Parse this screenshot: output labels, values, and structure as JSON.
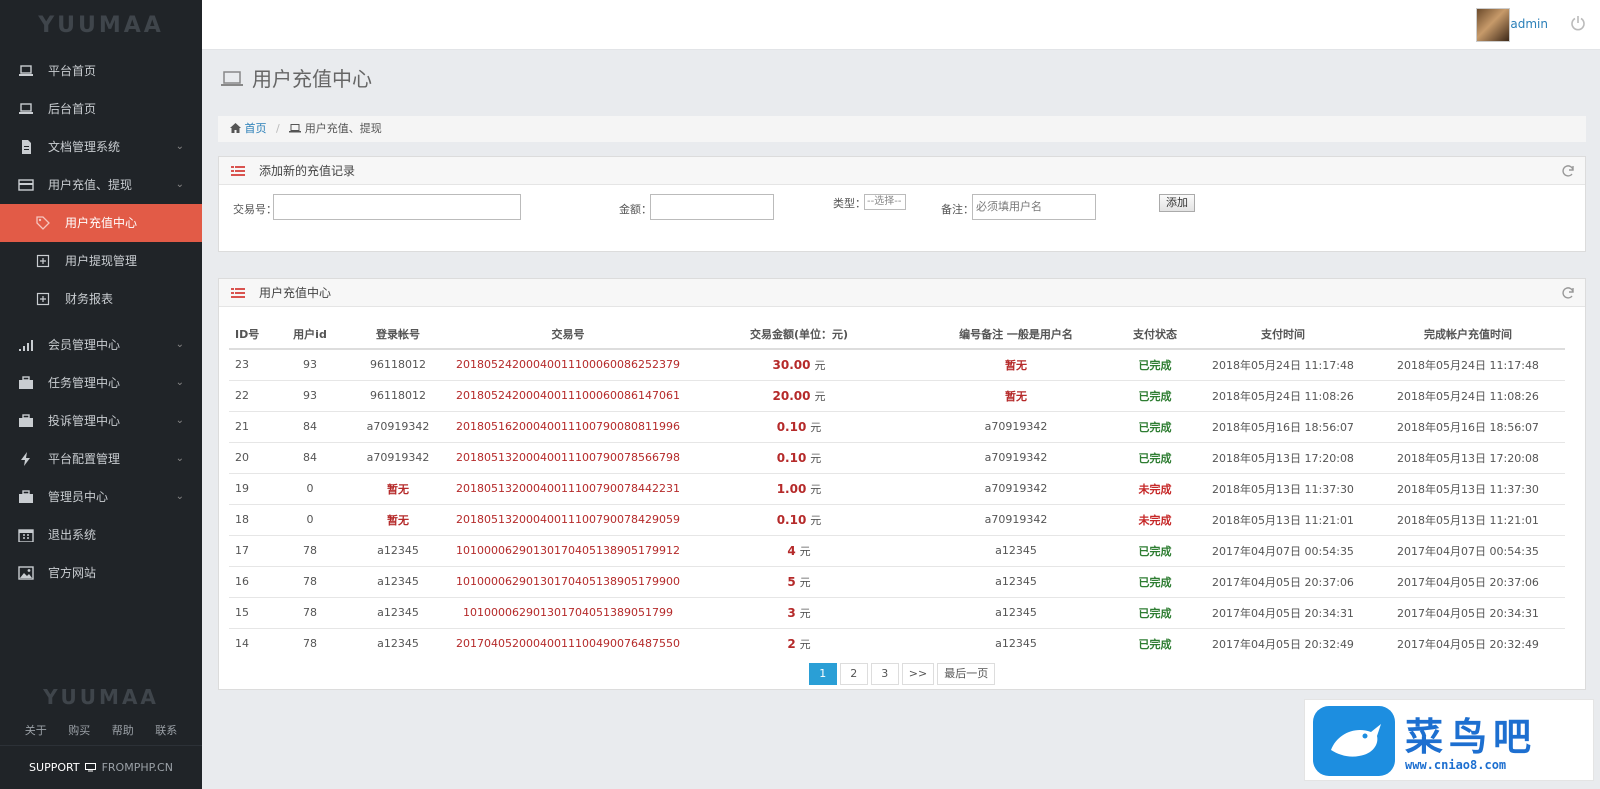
{
  "brand": {
    "logo_text": "YUUMAA"
  },
  "sidebar": {
    "items": [
      {
        "label": "平台首页",
        "icon": "laptop-icon"
      },
      {
        "label": "后台首页",
        "icon": "laptop-icon"
      },
      {
        "label": "文档管理系统",
        "icon": "document-icon",
        "expandable": true
      },
      {
        "label": "用户充值、提现",
        "icon": "card-icon",
        "expandable": true
      },
      {
        "label": "会员管理中心",
        "icon": "signal-icon",
        "expandable": true
      },
      {
        "label": "任务管理中心",
        "icon": "briefcase-icon",
        "expandable": true
      },
      {
        "label": "投诉管理中心",
        "icon": "briefcase-icon",
        "expandable": true
      },
      {
        "label": "平台配置管理",
        "icon": "bolt-icon",
        "expandable": true
      },
      {
        "label": "管理员中心",
        "icon": "briefcase-icon",
        "expandable": true
      },
      {
        "label": "退出系统",
        "icon": "calendar-icon"
      },
      {
        "label": "官方网站",
        "icon": "image-icon"
      }
    ],
    "subitems": [
      {
        "label": "用户充值中心",
        "icon": "tags-icon",
        "active": true
      },
      {
        "label": "用户提现管理",
        "icon": "plus-square-icon"
      },
      {
        "label": "财务报表",
        "icon": "plus-square-icon"
      }
    ],
    "footer": {
      "logo_text": "YUUMAA",
      "links": [
        "关于",
        "购买",
        "帮助",
        "联系"
      ],
      "support_label": "SUPPORT",
      "support_site": "FROMPHP.CN"
    }
  },
  "header": {
    "username": "admin"
  },
  "page": {
    "title": "用户充值中心",
    "breadcrumb": {
      "home": "首页",
      "current": "用户充值、提现"
    }
  },
  "add_form": {
    "panel_title": "添加新的充值记录",
    "txn_label": "交易号：",
    "txn_value": "",
    "amount_label": "金额：",
    "amount_value": "",
    "type_label": "类型：",
    "type_selected": "--选择--",
    "note_label": "备注：",
    "note_placeholder": "必须填用户名",
    "add_button": "添加"
  },
  "records": {
    "panel_title": "用户充值中心",
    "columns": [
      "ID号",
      "用户id",
      "登录帐号",
      "交易号",
      "交易金额(单位：元)",
      "编号备注 一般是用户名",
      "支付状态",
      "支付时间",
      "完成帐户充值时间"
    ],
    "unit": "元",
    "rows": [
      {
        "id": "23",
        "uid": "93",
        "account": "96118012",
        "txn": "201805242000400111000600862523​79",
        "amount": "30.00",
        "note": "暂无",
        "status": "已完成",
        "pay_time": "2018年05月24日 11:17:48",
        "done_time": "2018年05月24日 11:17:48"
      },
      {
        "id": "22",
        "uid": "93",
        "account": "96118012",
        "txn": "2018052420004001110006008614706​1",
        "amount": "20.00",
        "note": "暂无",
        "status": "已完成",
        "pay_time": "2018年05月24日 11:08:26",
        "done_time": "2018年05月24日 11:08:26"
      },
      {
        "id": "21",
        "uid": "84",
        "account": "a70919342",
        "txn": "2018051620004001110079008081199​6",
        "amount": "0.10",
        "note": "a70919342",
        "status": "已完成",
        "pay_time": "2018年05月16日 18:56:07",
        "done_time": "2018年05月16日 18:56:07"
      },
      {
        "id": "20",
        "uid": "84",
        "account": "a70919342",
        "txn": "2018051320004001110079007856679​8",
        "amount": "0.10",
        "note": "a70919342",
        "status": "已完成",
        "pay_time": "2018年05月13日 17:20:08",
        "done_time": "2018年05月13日 17:20:08"
      },
      {
        "id": "19",
        "uid": "0",
        "account": "暂无",
        "txn": "2018051320004001110079007844223​1",
        "amount": "1.00",
        "note": "a70919342",
        "status": "未完成",
        "pay_time": "2018年05月13日 11:37:30",
        "done_time": "2018年05月13日 11:37:30"
      },
      {
        "id": "18",
        "uid": "0",
        "account": "暂无",
        "txn": "2018051320004001110079007842905​9",
        "amount": "0.10",
        "note": "a70919342",
        "status": "未完成",
        "pay_time": "2018年05月13日 11:21:01",
        "done_time": "2018年05月13日 11:21:01"
      },
      {
        "id": "17",
        "uid": "78",
        "account": "a12345",
        "txn": "1010000629013017040513890517991​2",
        "amount": "4",
        "note": "a12345",
        "status": "已完成",
        "pay_time": "2017年04月07日 00:54:35",
        "done_time": "2017年04月07日 00:54:35"
      },
      {
        "id": "16",
        "uid": "78",
        "account": "a12345",
        "txn": "1010000629013017040513890517990​0",
        "amount": "5",
        "note": "a12345",
        "status": "已完成",
        "pay_time": "2017年04月05日 20:37:06",
        "done_time": "2017年04月05日 20:37:06"
      },
      {
        "id": "15",
        "uid": "78",
        "account": "a12345",
        "txn": "10100006290130170405138905179​9",
        "amount": "3",
        "note": "a12345",
        "status": "已完成",
        "pay_time": "2017年04月05日 20:34:31",
        "done_time": "2017年04月05日 20:34:31"
      },
      {
        "id": "14",
        "uid": "78",
        "account": "a12345",
        "txn": "2017040520004001110049007648755​0",
        "amount": "2",
        "note": "a12345",
        "status": "已完成",
        "pay_time": "2017年04月05日 20:32:49",
        "done_time": "2017年04月05日 20:32:49"
      }
    ]
  },
  "pagination": {
    "pages": [
      "1",
      "2",
      "3"
    ],
    "current": "1",
    "next": ">>",
    "last": "最后一页"
  },
  "watermark": {
    "title": "菜鸟吧",
    "url": "www.cniao8.com"
  },
  "colors": {
    "sidebar_bg": "#202428",
    "active_red": "#e25b47",
    "link_blue": "#2a7fb8",
    "page_active": "#2a9fd6",
    "amount_red": "#b52a2a",
    "status_green": "#2e7d32"
  }
}
